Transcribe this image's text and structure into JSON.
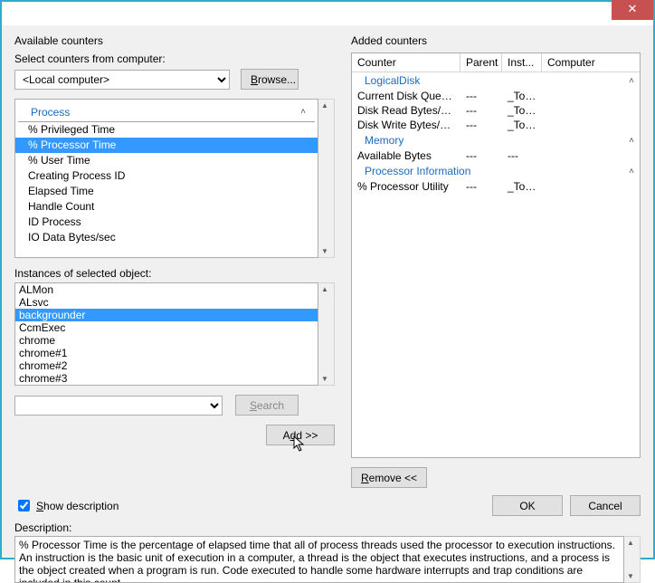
{
  "close": "✕",
  "left": {
    "title": "Available counters",
    "computer_label": "Select counters from computer:",
    "computer_value": "<Local computer>",
    "browse": "Browse...",
    "category": "Process",
    "counters": [
      "% Privileged Time",
      "% Processor Time",
      "% User Time",
      "Creating Process ID",
      "Elapsed Time",
      "Handle Count",
      "ID Process",
      "IO Data Bytes/sec"
    ],
    "counters_selected_index": 1,
    "instances_label": "Instances of selected object:",
    "instances": [
      "ALMon",
      "ALsvc",
      "backgrounder",
      "CcmExec",
      "chrome",
      "chrome#1",
      "chrome#2",
      "chrome#3"
    ],
    "instances_selected_index": 2,
    "search": "Search",
    "add": "Add >>"
  },
  "right": {
    "title": "Added counters",
    "headers": {
      "c1": "Counter",
      "c2": "Parent",
      "c3": "Inst...",
      "c4": "Computer"
    },
    "groups": [
      {
        "name": "LogicalDisk",
        "rows": [
          {
            "counter": "Current Disk Queue ...",
            "parent": "---",
            "inst": "_Total",
            "computer": ""
          },
          {
            "counter": "Disk Read Bytes/sec",
            "parent": "---",
            "inst": "_Total",
            "computer": ""
          },
          {
            "counter": "Disk Write Bytes/sec",
            "parent": "---",
            "inst": "_Total",
            "computer": ""
          }
        ]
      },
      {
        "name": "Memory",
        "rows": [
          {
            "counter": "Available Bytes",
            "parent": "---",
            "inst": "---",
            "computer": ""
          }
        ]
      },
      {
        "name": "Processor Information",
        "rows": [
          {
            "counter": "% Processor Utility",
            "parent": "---",
            "inst": "_Total",
            "computer": ""
          }
        ]
      }
    ],
    "remove": "Remove <<"
  },
  "bottom": {
    "show_desc": "Show description",
    "ok": "OK",
    "cancel": "Cancel",
    "desc_label": "Description:",
    "desc": "% Processor Time is the percentage of elapsed time that all of process threads used the processor to execution instructions. An instruction is the basic unit of execution in a computer, a thread is the object that executes instructions, and a process is the object created when a program is run. Code executed to handle some hardware interrupts and trap conditions are included in this count."
  }
}
